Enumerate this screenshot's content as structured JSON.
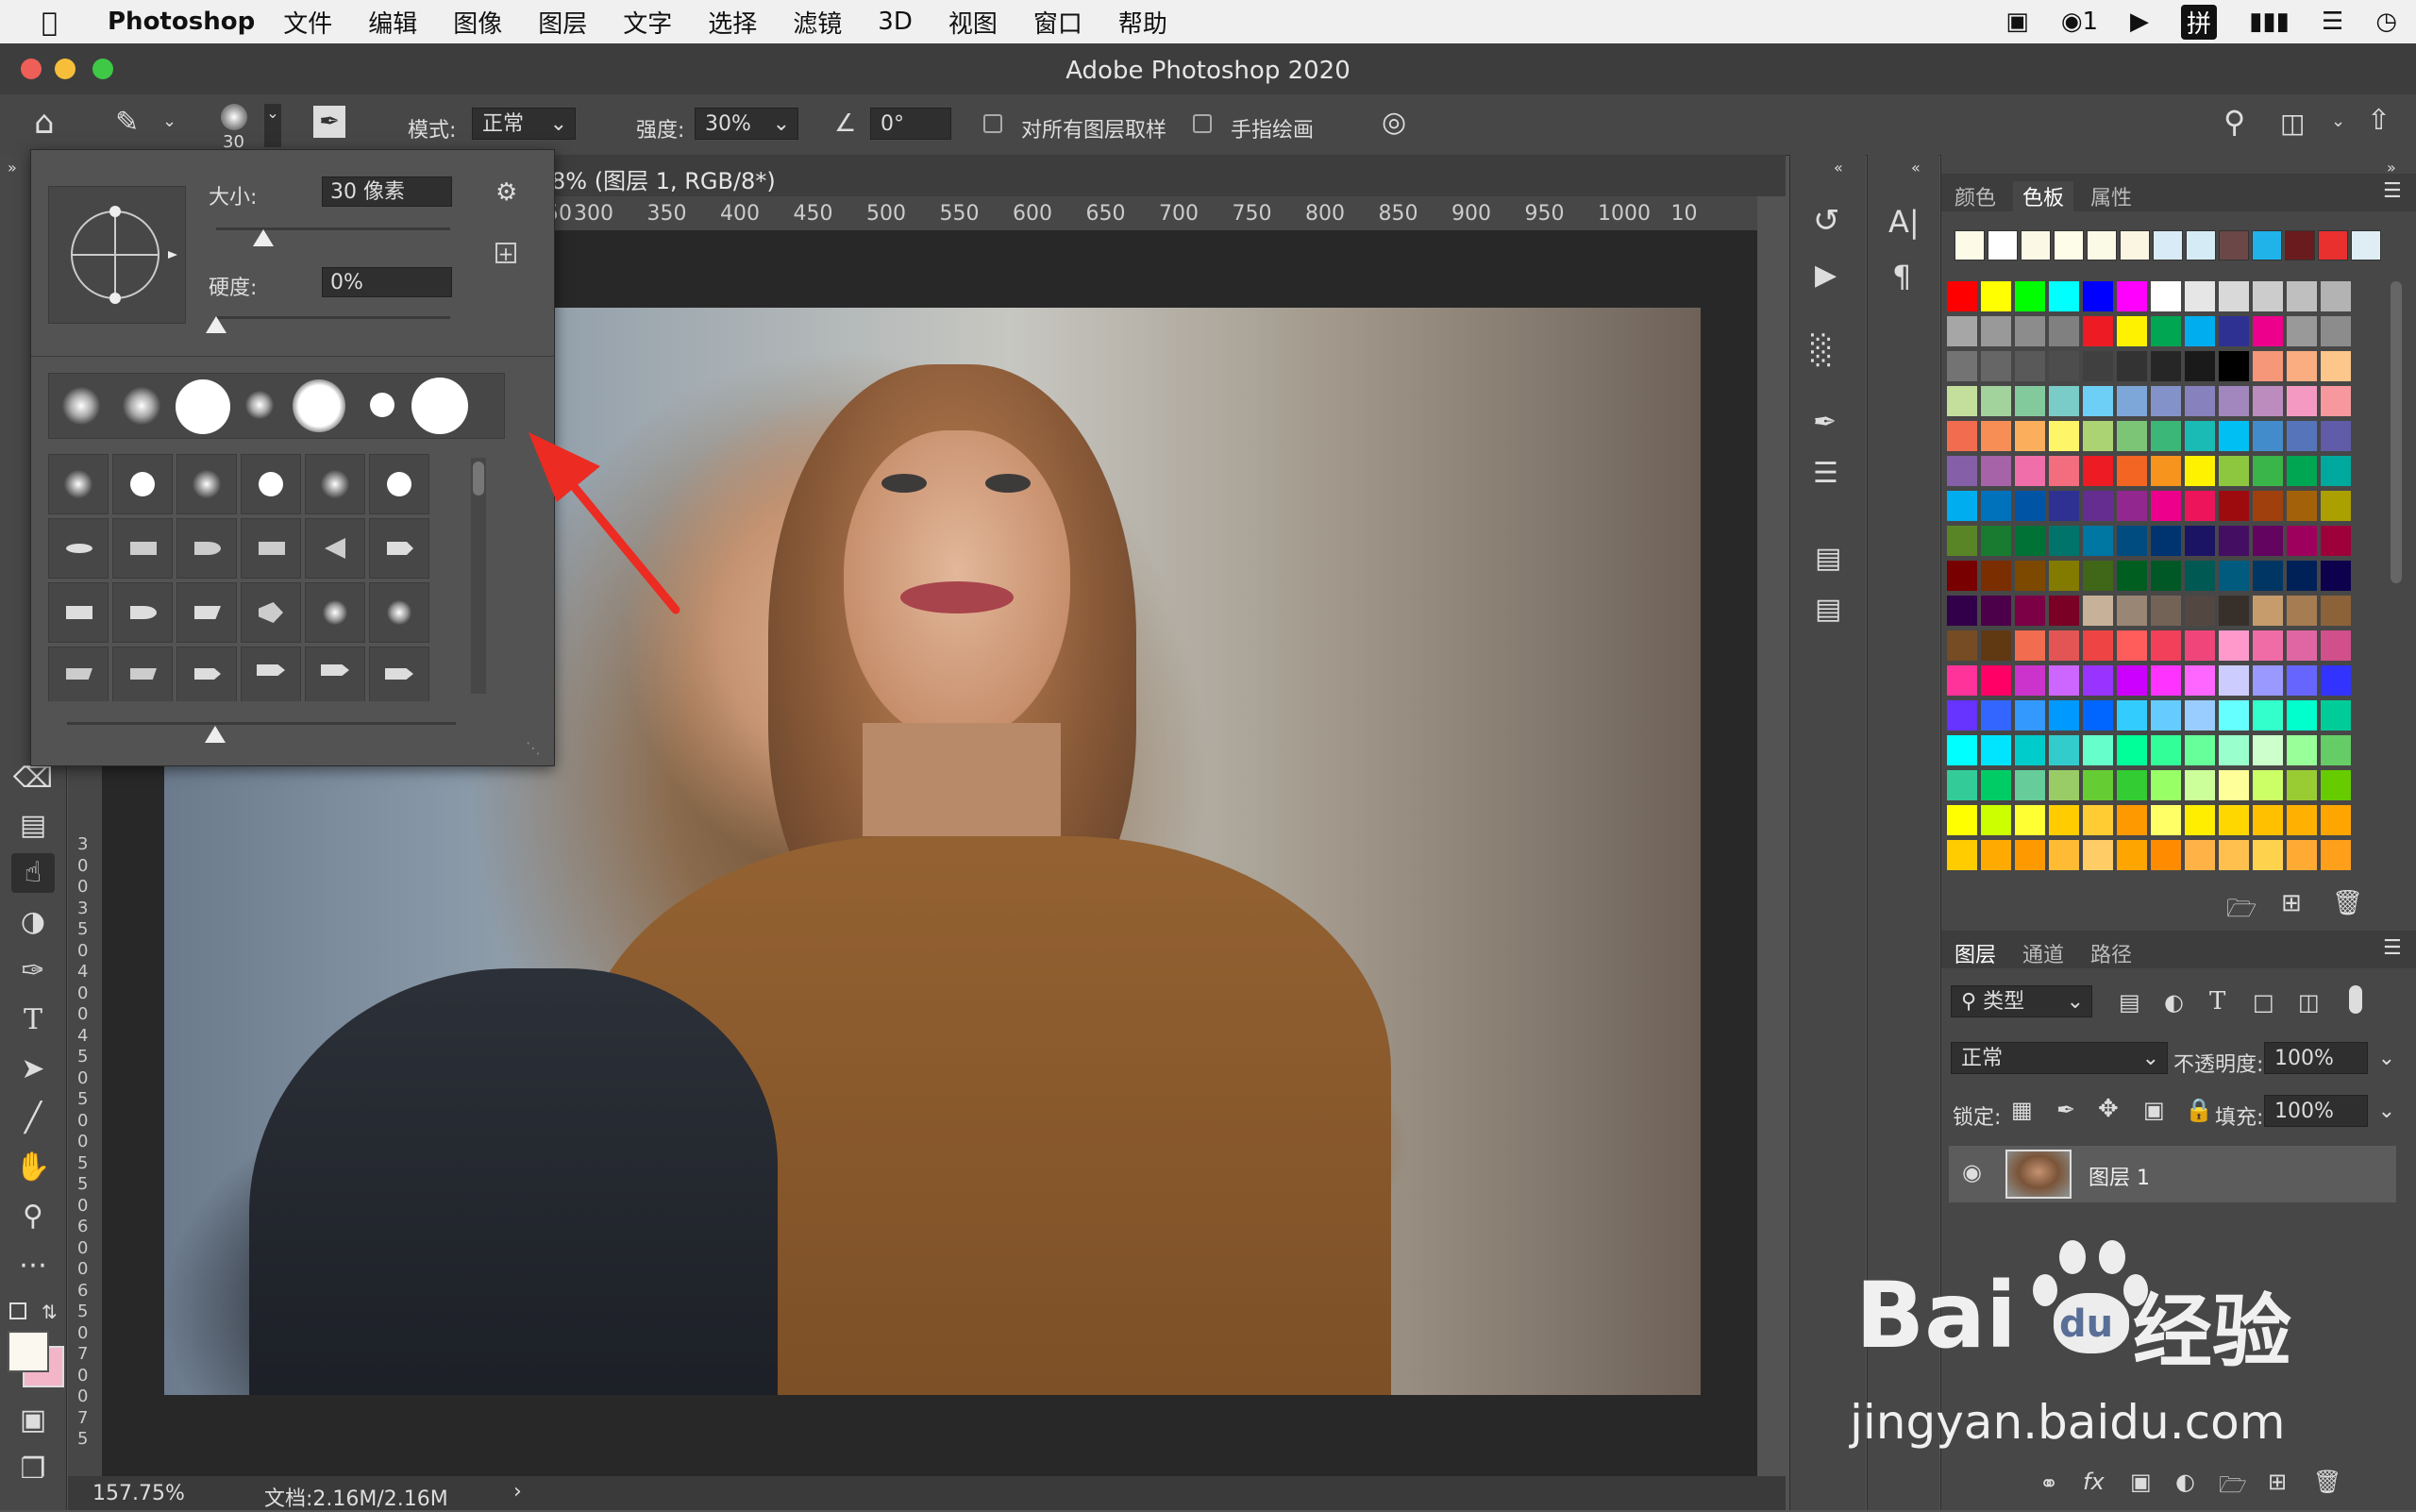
{
  "menubar": {
    "apple_icon": "apple-logo",
    "app_name": "Photoshop",
    "items": [
      "文件",
      "编辑",
      "图像",
      "图层",
      "文字",
      "选择",
      "滤镜",
      "3D",
      "视图",
      "窗口",
      "帮助"
    ],
    "wechat_count": "1",
    "ime": "拼"
  },
  "window": {
    "title": "Adobe Photoshop 2020"
  },
  "options": {
    "brush_size": "30",
    "mode_label": "模式:",
    "mode_value": "正常",
    "strength_label": "强度:",
    "strength_value": "30%",
    "angle_value": "0°",
    "sample_all_label": "对所有图层取样",
    "finger_paint_label": "手指绘画"
  },
  "brush_panel": {
    "size_label": "大小:",
    "size_value": "30 像素",
    "hardness_label": "硬度:",
    "hardness_value": "0%",
    "size_level": 0.2,
    "hardness_level": 0.0,
    "tip_size_level": 0.38,
    "cursor_icon": "brush-angle-roundness-icon",
    "gear_icon": "gear-icon"
  },
  "document": {
    "tab_title": "8% (图层 1, RGB/8*)",
    "ruler_top": [
      "50",
      "300",
      "350",
      "400",
      "450",
      "500",
      "550",
      "600",
      "650",
      "700",
      "750",
      "800",
      "850",
      "900",
      "950",
      "1000",
      "10"
    ],
    "ruler_left": [
      "3",
      "0",
      "0",
      "3",
      "5",
      "0",
      "4",
      "0",
      "0",
      "4",
      "5",
      "0",
      "5",
      "0",
      "0",
      "5",
      "5",
      "0",
      "6",
      "0",
      "0",
      "6",
      "5",
      "0",
      "7",
      "0",
      "0",
      "7",
      "5"
    ],
    "zoom": "157.75%",
    "doc_info": "文档:2.16M/2.16M"
  },
  "right_panel": {
    "swatch_tabs": [
      "颜色",
      "色板",
      "属性"
    ],
    "layer_tabs": [
      "图层",
      "通道",
      "路径"
    ],
    "filter_kind": "类型",
    "blend_mode": "正常",
    "opacity_label": "不透明度:",
    "opacity_value": "100%",
    "lock_label": "锁定:",
    "fill_label": "填充:",
    "fill_value": "100%",
    "layer_name": "图层 1",
    "recent_swatches": [
      "#fdfbe8",
      "#ffffff",
      "#fbf8e6",
      "#fefde9",
      "#fbfae6",
      "#fbf6e2",
      "#d8ebf7",
      "#d5ebf5",
      "#6b4747",
      "#1fb3e9",
      "#6a1b1d",
      "#ea2f2f",
      "#dfeef5"
    ]
  },
  "watermark": {
    "brand": "Bai",
    "brand2": "du",
    "cn": "经验",
    "url": "jingyan.baidu.com"
  }
}
